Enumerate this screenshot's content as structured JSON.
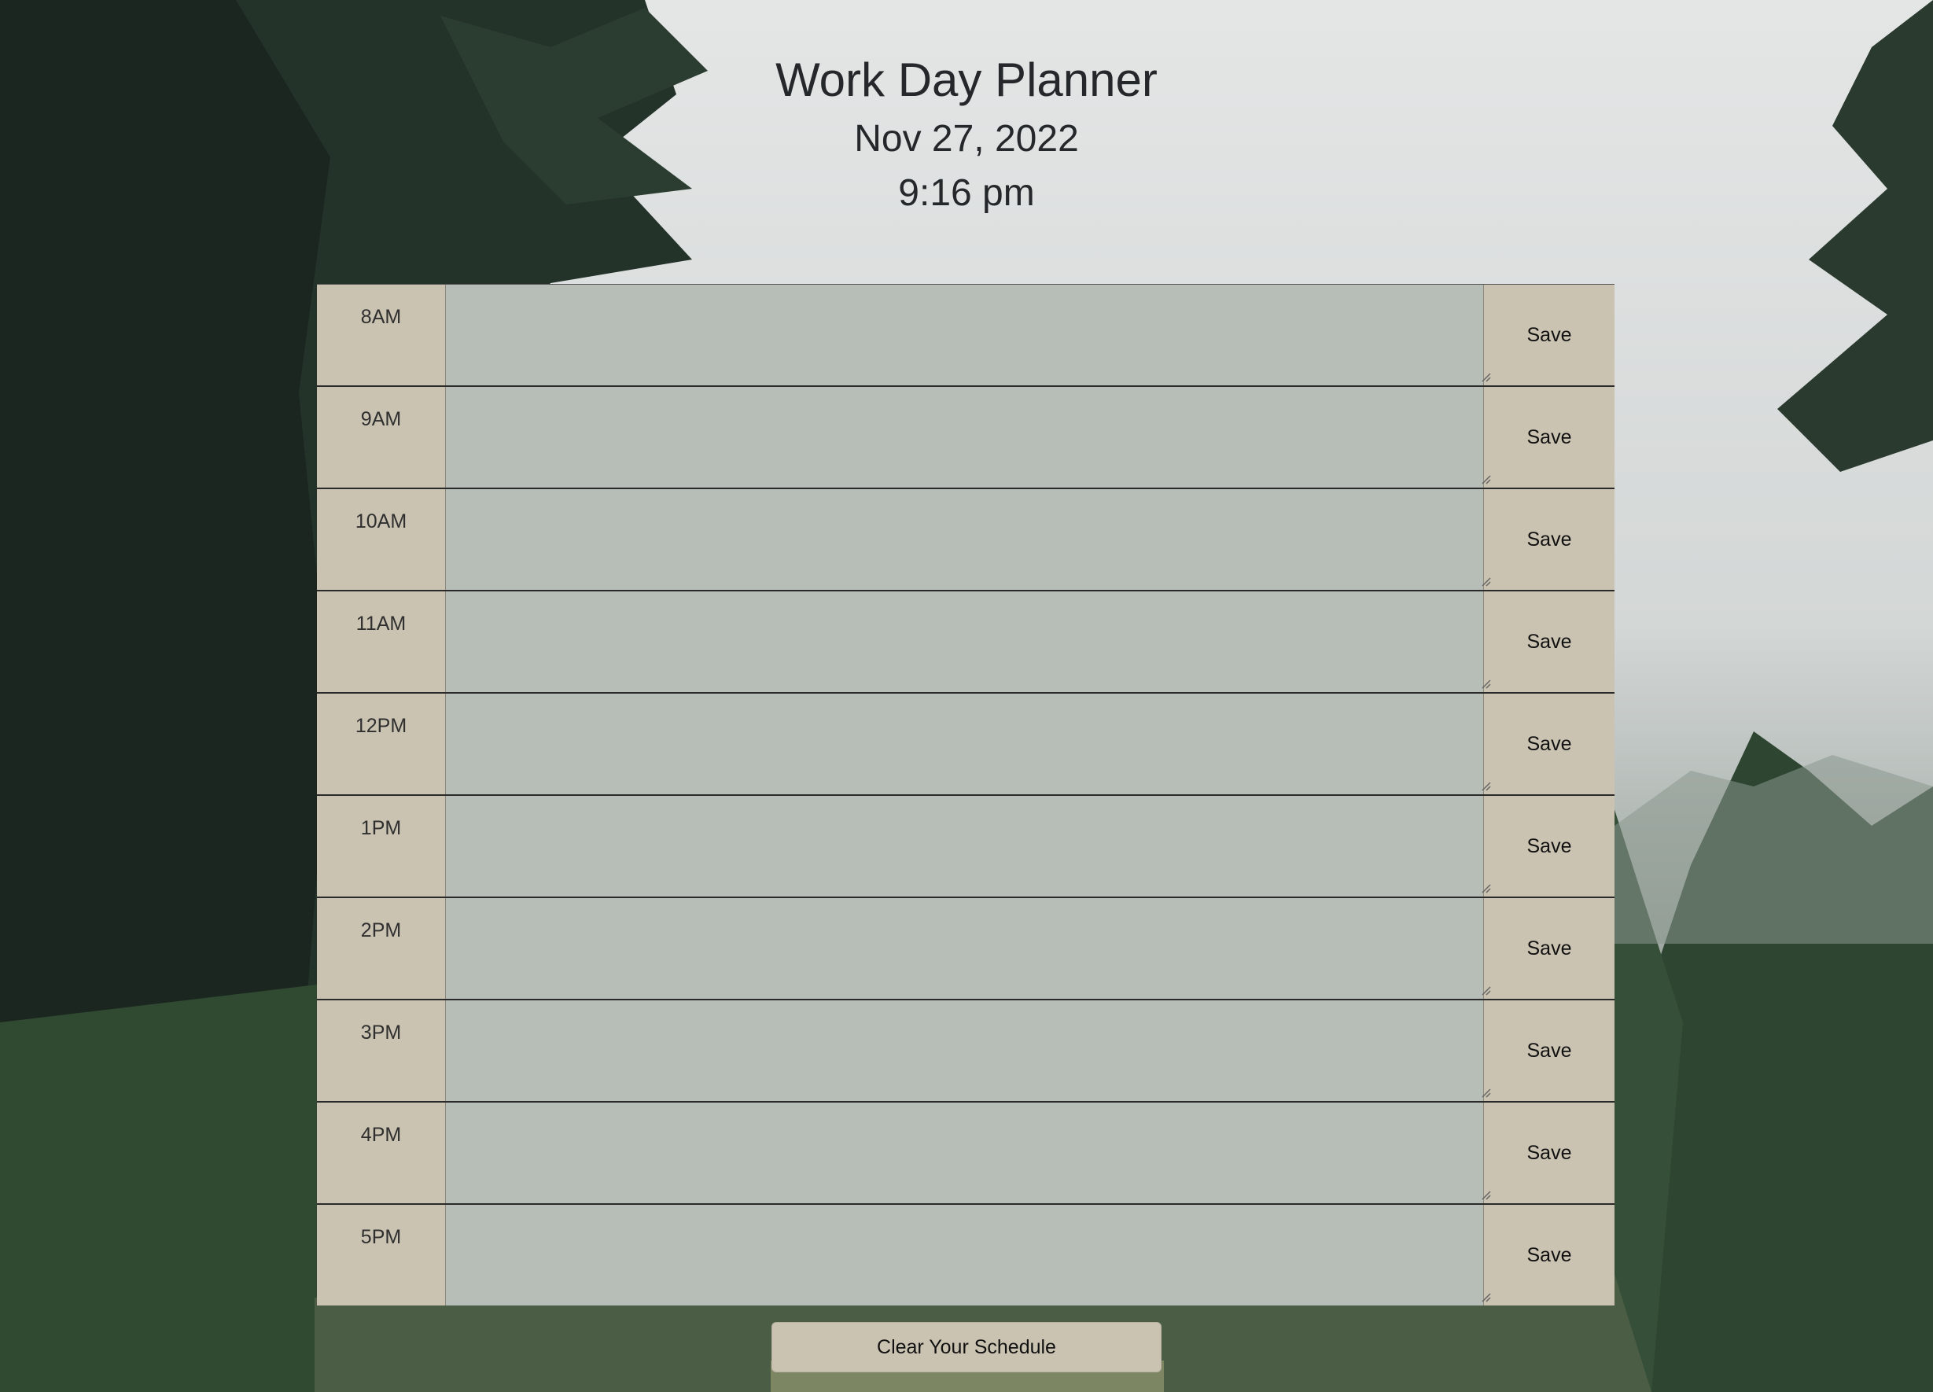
{
  "header": {
    "title": "Work Day Planner",
    "date": "Nov 27, 2022",
    "time": "9:16 pm"
  },
  "planner": {
    "rows": [
      {
        "hour": "8AM",
        "text": "",
        "save_label": "Save"
      },
      {
        "hour": "9AM",
        "text": "",
        "save_label": "Save"
      },
      {
        "hour": "10AM",
        "text": "",
        "save_label": "Save"
      },
      {
        "hour": "11AM",
        "text": "",
        "save_label": "Save"
      },
      {
        "hour": "12PM",
        "text": "",
        "save_label": "Save"
      },
      {
        "hour": "1PM",
        "text": "",
        "save_label": "Save"
      },
      {
        "hour": "2PM",
        "text": "",
        "save_label": "Save"
      },
      {
        "hour": "3PM",
        "text": "",
        "save_label": "Save"
      },
      {
        "hour": "4PM",
        "text": "",
        "save_label": "Save"
      },
      {
        "hour": "5PM",
        "text": "",
        "save_label": "Save"
      }
    ]
  },
  "footer": {
    "clear_label": "Clear Your Schedule"
  },
  "colors": {
    "hour_bg": "#cbc3b2",
    "textarea_bg": "#b7bdb7",
    "save_bg": "#cbc3b2",
    "title_text": "#24282a"
  },
  "icons": {
    "background": "forest-background-image",
    "textarea_grip": "resize-grip-icon"
  }
}
